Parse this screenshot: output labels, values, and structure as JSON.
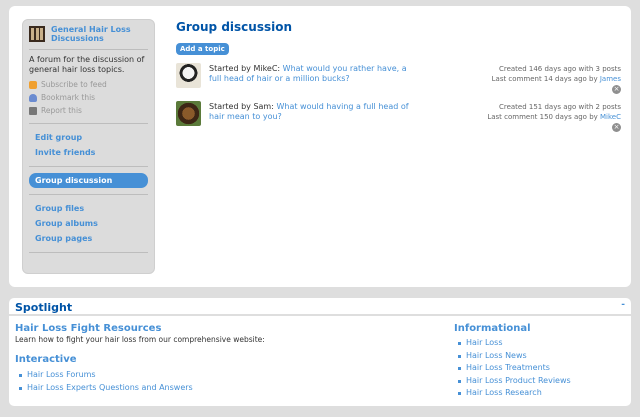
{
  "sidebar": {
    "group_name": "General Hair Loss Discussions",
    "description": "A forum for the discussion of general hair loss topics.",
    "owner_links": [
      {
        "icon": "rss-icon",
        "label": "Subscribe to feed"
      },
      {
        "icon": "bookmark-icon",
        "label": "Bookmark this"
      },
      {
        "icon": "report-icon",
        "label": "Report this"
      }
    ],
    "menu_top": [
      "Edit group",
      "Invite friends"
    ],
    "menu_selected": "Group discussion",
    "menu_bottom": [
      "Group files",
      "Group albums",
      "Group pages"
    ]
  },
  "main": {
    "title": "Group discussion",
    "add_topic_label": "Add a topic",
    "topics": [
      {
        "started_by": "Started by MikeC:",
        "title": "What would you rather have, a full head of hair or a million bucks?",
        "created": "Created 146 days ago with 3 posts",
        "last_comment_prefix": "Last comment 14 days ago by",
        "last_comment_user": "James",
        "delete_glyph": "×"
      },
      {
        "started_by": "Started by Sam:",
        "title": "What would having a full head of hair mean to you?",
        "created": "Created 151 days ago with 2 posts",
        "last_comment_prefix": "Last comment 150 days ago by",
        "last_comment_user": "MikeC",
        "delete_glyph": "×"
      }
    ]
  },
  "spotlight": {
    "title": "Spotlight",
    "toggle_glyph": "-",
    "resources_heading": "Hair Loss Fight Resources",
    "resources_text": "Learn how to fight your hair loss from our comprehensive website:",
    "interactive_heading": "Interactive",
    "interactive_links": [
      "Hair Loss Forums",
      "Hair Loss Experts Questions and Answers"
    ],
    "informational_heading": "Informational",
    "informational_links": [
      "Hair Loss",
      "Hair Loss News",
      "Hair Loss Treatments",
      "Hair Loss Product Reviews",
      "Hair Loss Research"
    ]
  },
  "colors": {
    "accent": "#4690d6",
    "heading": "#0054a7",
    "background": "#dedede"
  }
}
